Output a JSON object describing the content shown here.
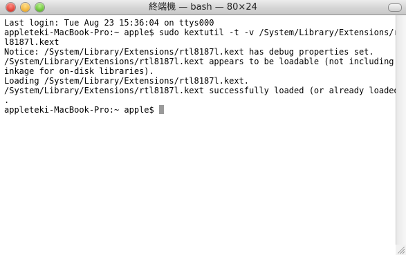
{
  "window": {
    "title": "終端機 — bash — 80×24"
  },
  "titlebar": {
    "close_glyph": "×",
    "minimize_glyph": "−",
    "zoom_glyph": "+"
  },
  "terminal": {
    "lines": [
      "Last login: Tue Aug 23 15:36:04 on ttys000",
      "appleteki-MacBook-Pro:~ apple$ sudo kextutil -t -v /System/Library/Extensions/rt",
      "l8187l.kext",
      "Notice: /System/Library/Extensions/rtl8187l.kext has debug properties set.",
      "/System/Library/Extensions/rtl8187l.kext appears to be loadable (not including l",
      "inkage for on-disk libraries).",
      "Loading /System/Library/Extensions/rtl8187l.kext.",
      "/System/Library/Extensions/rtl8187l.kext successfully loaded (or already loaded)",
      ".",
      "appleteki-MacBook-Pro:~ apple$ "
    ]
  },
  "scrollbar": {
    "up_glyph": "▲",
    "down_glyph": "▼"
  },
  "colors": {
    "text": "#000000",
    "background": "#ffffff",
    "cursor": "#9a9a9a"
  }
}
